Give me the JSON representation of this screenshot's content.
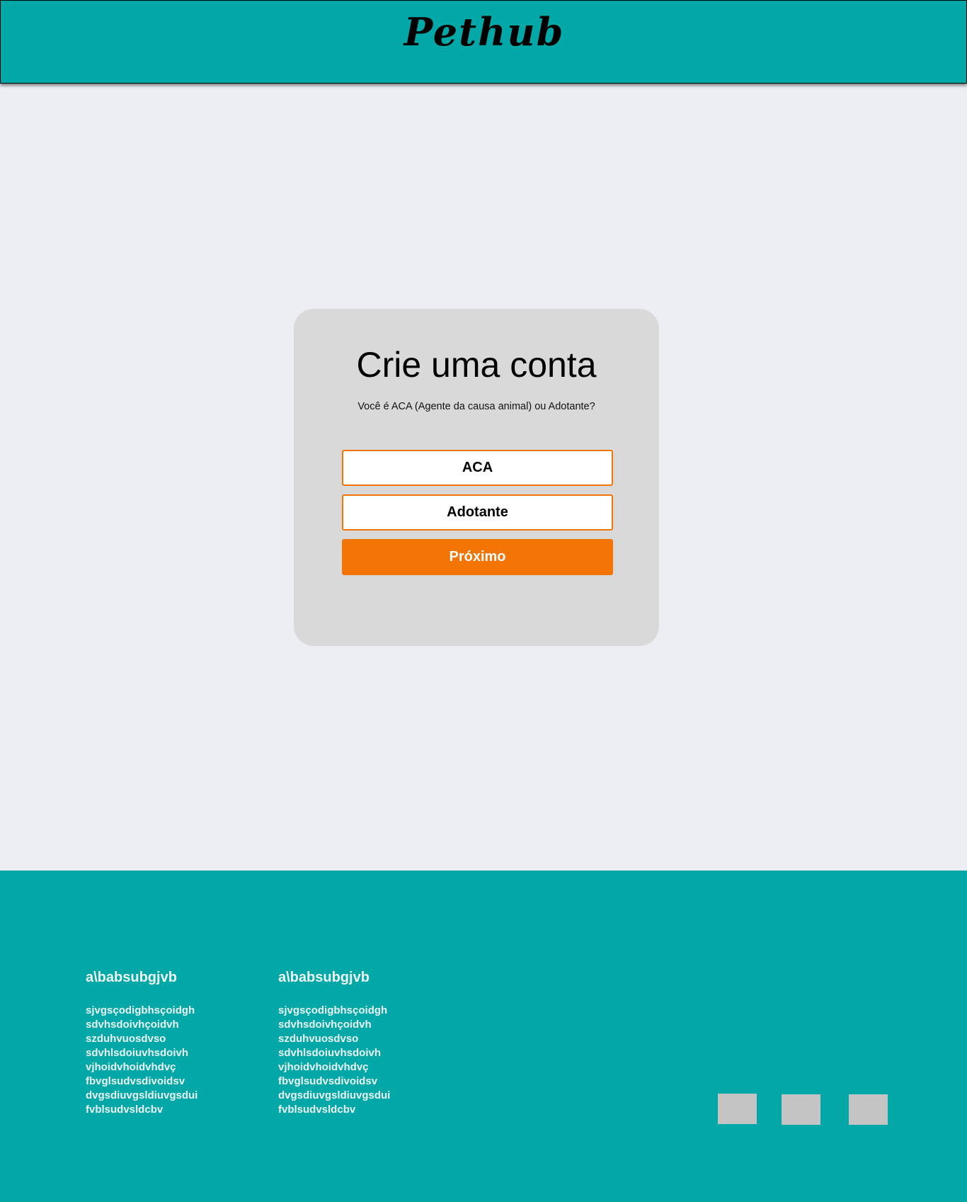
{
  "header": {
    "logo": "Pethub"
  },
  "card": {
    "title": "Crie uma conta",
    "subtitle": "Você é ACA (Agente da causa animal) ou Adotante?",
    "options": [
      "ACA",
      "Adotante"
    ],
    "next_label": "Próximo"
  },
  "footer": {
    "columns": [
      {
        "heading": "a\\babsubgjvb",
        "links": [
          "sjvgsçodigbhsçoidgh",
          "sdvhsdoivhçoidvh",
          "szduhvuosdvso",
          "sdvhlsdoiuvhsdoivh",
          "vjhoidvhoidvhdvç",
          "fbvglsudvsdivoidsv",
          "dvgsdiuvgsldiuvgsdui",
          "fvblsudvsldcbv"
        ]
      },
      {
        "heading": "a\\babsubgjvb",
        "links": [
          "sjvgsçodigbhsçoidgh",
          "sdvhsdoivhçoidvh",
          "szduhvuosdvso",
          "sdvhlsdoiuvhsdoivh",
          "vjhoidvhoidvhdvç",
          "fbvglsudvsdivoidsv",
          "dvgsdiuvgsldiuvgsdui",
          "fvblsudvsldcbv"
        ]
      }
    ]
  },
  "colors": {
    "teal": "#02a8a8",
    "orange": "#f27405",
    "card_bg": "#d9d9d9",
    "page_bg": "#edeef3"
  }
}
